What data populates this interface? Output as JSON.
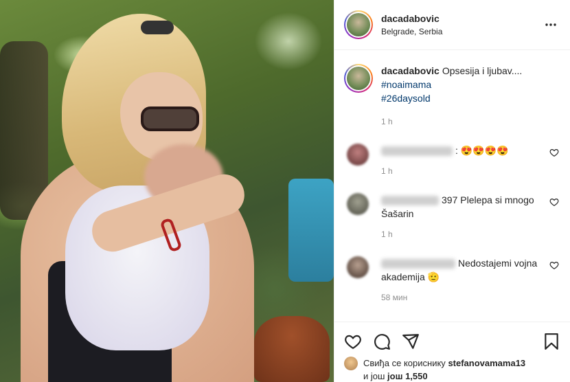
{
  "post": {
    "username": "dacadabovic",
    "location": "Belgrade, Serbia",
    "more_icon": "more-horizontal-icon",
    "caption": {
      "username": "dacadabovic",
      "text": "Opsesija i ljubav....",
      "hashtags": [
        "#noaimama",
        "#26daysold"
      ],
      "time": "1 h"
    }
  },
  "comments": [
    {
      "text": ": 😍😍😍😍",
      "time": "1 h",
      "avatar_color": "#7a4a4a"
    },
    {
      "text": "397 Plelepa si mnogo Šašarin",
      "time": "1 h",
      "avatar_color": "#6a6a5a"
    },
    {
      "text": "Nedostajemi vojna akademija 🫡",
      "time": "58 мин",
      "avatar_color": "#8a7a70"
    }
  ],
  "actions": {
    "like_icon": "heart-icon",
    "comment_icon": "comment-icon",
    "share_icon": "send-icon",
    "save_icon": "bookmark-icon"
  },
  "likes": {
    "prefix": "Свиђа се кориснику",
    "user": "stefanovamama13",
    "line2_prefix": "и још",
    "line2_bold_word": "још",
    "count": "1,550"
  },
  "colors": {
    "hashtag": "#00376b",
    "muted": "#8e8e8e",
    "text": "#262626"
  }
}
